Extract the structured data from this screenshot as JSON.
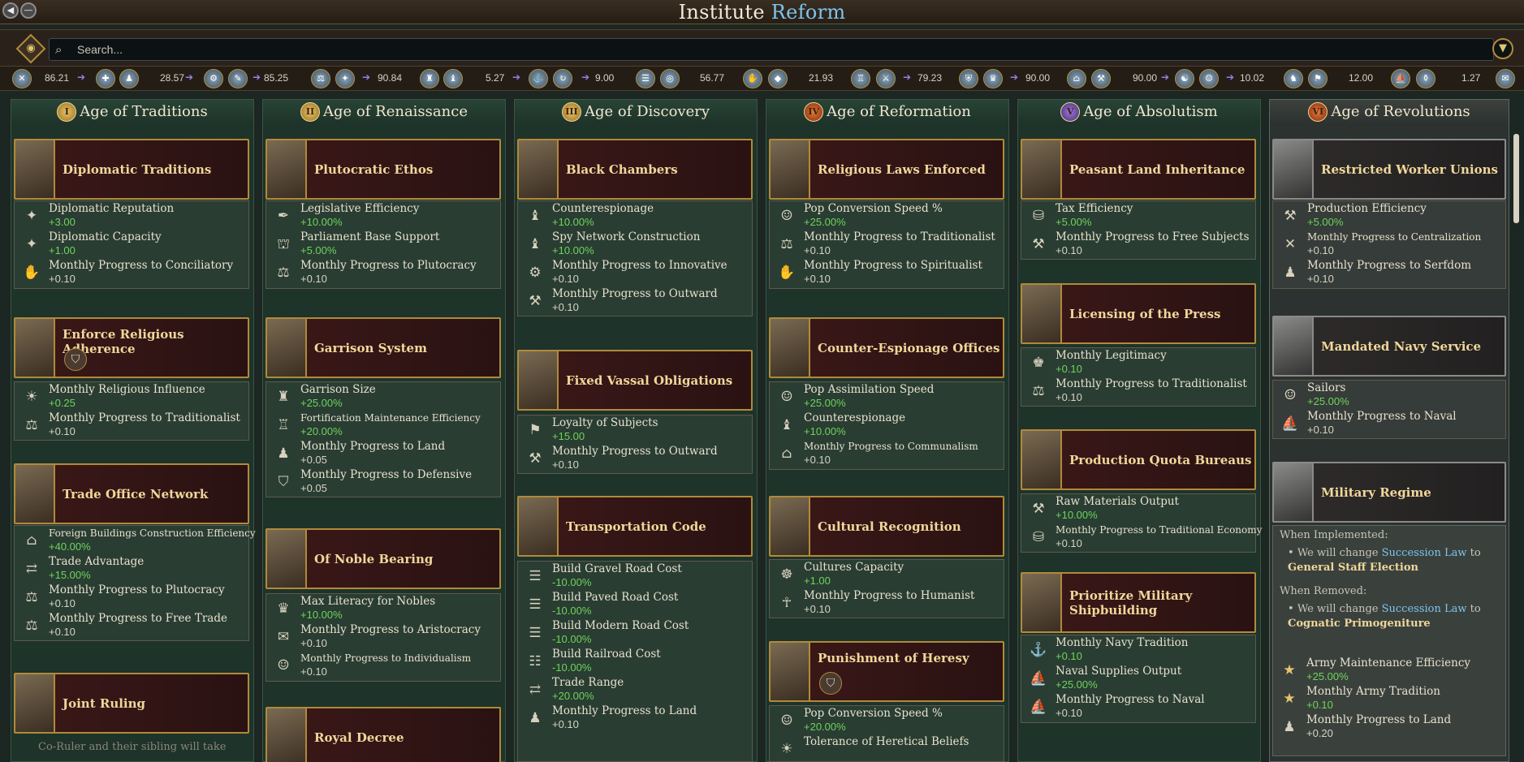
{
  "title": {
    "prefix": "Institute",
    "highlight": "Reform"
  },
  "search": {
    "placeholder": "Search..."
  },
  "stats": [
    "86.21",
    "28.57",
    "85.25",
    "90.84",
    "5.27",
    "9.00",
    "56.77",
    "21.93",
    "79.23",
    "90.00",
    "90.00",
    "10.02",
    "12.00",
    "1.27"
  ],
  "columns": [
    {
      "numeral": "I",
      "title": "Age of Traditions"
    },
    {
      "numeral": "II",
      "title": "Age of Renaissance"
    },
    {
      "numeral": "III",
      "title": "Age of Discovery"
    },
    {
      "numeral": "IV",
      "title": "Age of Reformation"
    },
    {
      "numeral": "V",
      "title": "Age of Absolutism"
    },
    {
      "numeral": "VI",
      "title": "Age of Revolutions"
    }
  ],
  "cards": {
    "c1": [
      {
        "title": "Diplomatic Traditions",
        "effects": [
          {
            "name": "Diplomatic Reputation",
            "value": "+3.00"
          },
          {
            "name": "Diplomatic Capacity",
            "value": "+1.00"
          },
          {
            "name": "Monthly Progress to Conciliatory",
            "value": "+0.10"
          }
        ]
      },
      {
        "title": "Enforce Religious Adherence",
        "effects": [
          {
            "name": "Monthly Religious Influence",
            "value": "+0.25"
          },
          {
            "name": "Monthly Progress to Traditionalist",
            "value": "+0.10"
          }
        ]
      },
      {
        "title": "Trade Office Network",
        "effects": [
          {
            "name": "Foreign Buildings Construction Efficiency",
            "value": "+40.00%"
          },
          {
            "name": "Trade Advantage",
            "value": "+15.00%"
          },
          {
            "name": "Monthly Progress to Plutocracy",
            "value": "+0.10"
          },
          {
            "name": "Monthly Progress to Free Trade",
            "value": "+0.10"
          }
        ]
      },
      {
        "title": "Joint Ruling",
        "effects": []
      }
    ],
    "c2": [
      {
        "title": "Plutocratic Ethos",
        "effects": [
          {
            "name": "Legislative Efficiency",
            "value": "+10.00%"
          },
          {
            "name": "Parliament Base Support",
            "value": "+5.00%"
          },
          {
            "name": "Monthly Progress to Plutocracy",
            "value": "+0.10"
          }
        ]
      },
      {
        "title": "Garrison System",
        "effects": [
          {
            "name": "Garrison Size",
            "value": "+25.00%"
          },
          {
            "name": "Fortification Maintenance Efficiency",
            "value": "+20.00%"
          },
          {
            "name": "Monthly Progress to Land",
            "value": "+0.05"
          },
          {
            "name": "Monthly Progress to Defensive",
            "value": "+0.05"
          }
        ]
      },
      {
        "title": "Of Noble Bearing",
        "effects": [
          {
            "name": "Max Literacy for Nobles",
            "value": "+10.00%"
          },
          {
            "name": "Monthly Progress to Aristocracy",
            "value": "+0.10"
          },
          {
            "name": "Monthly Progress to Individualism",
            "value": "+0.10"
          }
        ]
      },
      {
        "title": "Royal Decree",
        "effects": []
      }
    ],
    "c3": [
      {
        "title": "Black Chambers",
        "effects": [
          {
            "name": "Counterespionage",
            "value": "+10.00%"
          },
          {
            "name": "Spy Network Construction",
            "value": "+10.00%"
          },
          {
            "name": "Monthly Progress to Innovative",
            "value": "+0.10"
          },
          {
            "name": "Monthly Progress to Outward",
            "value": "+0.10"
          }
        ]
      },
      {
        "title": "Fixed Vassal Obligations",
        "effects": [
          {
            "name": "Loyalty of Subjects",
            "value": "+15.00"
          },
          {
            "name": "Monthly Progress to Outward",
            "value": "+0.10"
          }
        ]
      },
      {
        "title": "Transportation Code",
        "effects": [
          {
            "name": "Build Gravel Road Cost",
            "value": "-10.00%"
          },
          {
            "name": "Build Paved Road Cost",
            "value": "-10.00%"
          },
          {
            "name": "Build Modern Road Cost",
            "value": "-10.00%"
          },
          {
            "name": "Build Railroad Cost",
            "value": "-10.00%"
          },
          {
            "name": "Trade Range",
            "value": "+20.00%"
          },
          {
            "name": "Monthly Progress to Land",
            "value": "+0.10"
          }
        ]
      }
    ],
    "c4": [
      {
        "title": "Religious Laws Enforced",
        "effects": [
          {
            "name": "Pop Conversion Speed %",
            "value": "+25.00%"
          },
          {
            "name": "Monthly Progress to Traditionalist",
            "value": "+0.10"
          },
          {
            "name": "Monthly Progress to Spiritualist",
            "value": "+0.10"
          }
        ]
      },
      {
        "title": "Counter-Espionage Offices",
        "effects": [
          {
            "name": "Pop Assimilation Speed",
            "value": "+25.00%"
          },
          {
            "name": "Counterespionage",
            "value": "+10.00%"
          },
          {
            "name": "Monthly Progress to Communalism",
            "value": "+0.10"
          }
        ]
      },
      {
        "title": "Cultural Recognition",
        "effects": [
          {
            "name": "Cultures Capacity",
            "value": "+1.00"
          },
          {
            "name": "Monthly Progress to Humanist",
            "value": "+0.10"
          }
        ]
      },
      {
        "title": "Punishment of Heresy",
        "effects": [
          {
            "name": "Pop Conversion Speed %",
            "value": "+20.00%"
          },
          {
            "name": "Tolerance of Heretical Beliefs",
            "value": ""
          }
        ]
      }
    ],
    "c5": [
      {
        "title": "Peasant Land Inheritance",
        "effects": [
          {
            "name": "Tax Efficiency",
            "value": "+5.00%"
          },
          {
            "name": "Monthly Progress to Free Subjects",
            "value": "+0.10"
          }
        ]
      },
      {
        "title": "Licensing of the Press",
        "effects": [
          {
            "name": "Monthly Legitimacy",
            "value": "+0.10"
          },
          {
            "name": "Monthly Progress to Traditionalist",
            "value": "+0.10"
          }
        ]
      },
      {
        "title": "Production Quota Bureaus",
        "effects": [
          {
            "name": "Raw Materials Output",
            "value": "+10.00%"
          },
          {
            "name": "Monthly Progress to Traditional Economy",
            "value": "+0.10"
          }
        ]
      },
      {
        "title": "Prioritize Military Shipbuilding",
        "effects": [
          {
            "name": "Monthly Navy Tradition",
            "value": "+0.10"
          },
          {
            "name": "Naval Supplies Output",
            "value": "+25.00%"
          },
          {
            "name": "Monthly Progress to Naval",
            "value": "+0.10"
          }
        ]
      }
    ],
    "c6": [
      {
        "title": "Restricted Worker Unions",
        "effects": [
          {
            "name": "Production Efficiency",
            "value": "+5.00%"
          },
          {
            "name": "Monthly Progress to Centralization",
            "value": "+0.10"
          },
          {
            "name": "Monthly Progress to Serfdom",
            "value": "+0.10"
          }
        ]
      },
      {
        "title": "Mandated Navy Service",
        "effects": [
          {
            "name": "Sailors",
            "value": "+25.00%"
          },
          {
            "name": "Monthly Progress to Naval",
            "value": "+0.10"
          }
        ]
      },
      {
        "title": "Military Regime",
        "effects": [
          {
            "name": "Army Maintenance Efficiency",
            "value": "+25.00%"
          },
          {
            "name": "Monthly Army Tradition",
            "value": "+0.10"
          },
          {
            "name": "Monthly Progress to Land",
            "value": "+0.20"
          }
        ]
      }
    ]
  },
  "military_regime_notes": {
    "implemented_header": "When Implemented:",
    "implemented_text": "We will change",
    "implemented_law": "Succession Law",
    "implemented_to": "to",
    "implemented_value": "General Staff Election",
    "removed_header": "When Removed:",
    "removed_text": "We will change",
    "removed_law": "Succession Law",
    "removed_to": "to",
    "removed_value": "Cognatic Primogeniture"
  },
  "joint_ruling_fragment": "Co-Ruler and their sibling will take"
}
